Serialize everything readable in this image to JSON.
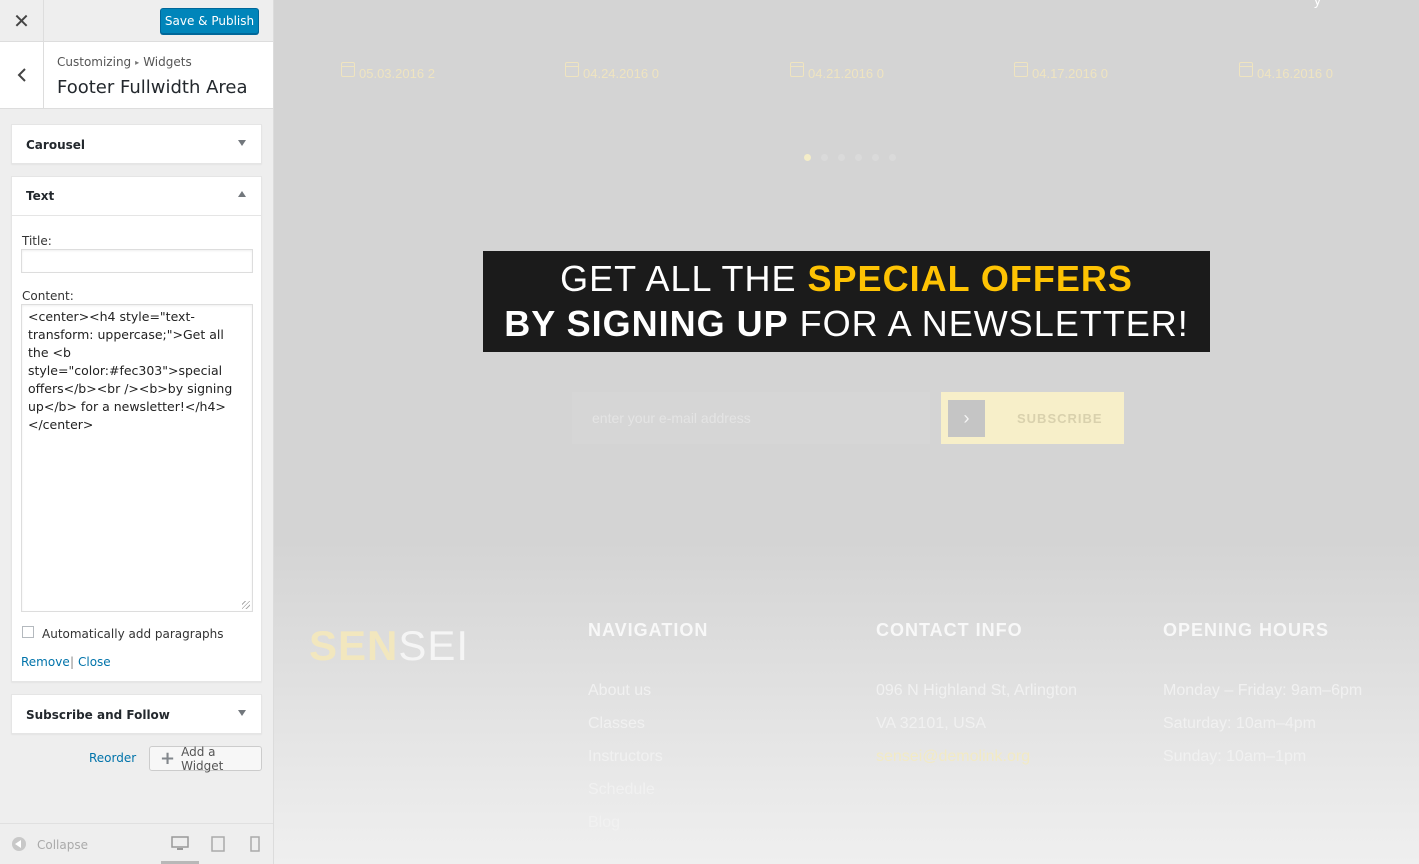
{
  "sidebar": {
    "close_glyph": "✕",
    "save_label": "Save & Publish",
    "breadcrumb": {
      "root": "Customizing",
      "separator": "▸",
      "current": "Widgets"
    },
    "section_title": "Footer Fullwidth Area",
    "widgets": {
      "carousel": {
        "title": "Carousel"
      },
      "text": {
        "title": "Text",
        "title_label": "Title:",
        "title_value": "",
        "content_label": "Content:",
        "content_value": "<center><h4 style=\"text-transform: uppercase;\">Get all the <b style=\"color:#fec303\">special offers</b><br /><b>by signing up</b> for a newsletter!</h4></center>",
        "autop_label": "Automatically add paragraphs",
        "autop_checked": false,
        "remove_label": "Remove",
        "link_separator": "|",
        "close_label": "Close"
      },
      "subscribe": {
        "title": "Subscribe and Follow"
      }
    },
    "reorder_label": "Reorder",
    "add_widget_label": "Add a Widget",
    "collapse_label": "Collapse",
    "devices": [
      "desktop-icon",
      "tablet-icon",
      "mobile-icon"
    ],
    "active_device": "desktop"
  },
  "preview": {
    "top_glyph": "y",
    "post_dates": [
      {
        "date": "05.03.2016",
        "count": "2"
      },
      {
        "date": "04.24.2016",
        "count": "0"
      },
      {
        "date": "04.21.2016",
        "count": "0"
      },
      {
        "date": "04.17.2016",
        "count": "0"
      },
      {
        "date": "04.16.2016",
        "count": "0"
      }
    ],
    "carousel_dots": 6,
    "carousel_active_dot": 0,
    "promo": {
      "line1_plain": "GET ALL THE ",
      "line1_highlight": "SPECIAL OFFERS",
      "line2_bold": "BY SIGNING UP",
      "line2_plain": " FOR A NEWSLETTER!",
      "highlight_color": "#fec303"
    },
    "newsletter": {
      "placeholder": "enter your e-mail address",
      "button_arrow": "›",
      "button_label": "SUBSCRIBE"
    },
    "logo": {
      "bold": "SEN",
      "light": "SEI"
    },
    "footer": {
      "navigation": {
        "heading": "NAVIGATION",
        "links": [
          "About us",
          "Classes",
          "Instructors",
          "Schedule",
          "Blog"
        ]
      },
      "contact": {
        "heading": "CONTACT INFO",
        "address_line1": "096 N Highland St, Arlington",
        "address_line2": "VA 32101, USA",
        "email": "sensei@demolink.org"
      },
      "hours": {
        "heading": "OPENING HOURS",
        "lines": [
          "Monday – Friday: 9am–6pm",
          "Saturday: 10am–4pm",
          "Sunday: 10am–1pm"
        ]
      }
    }
  }
}
